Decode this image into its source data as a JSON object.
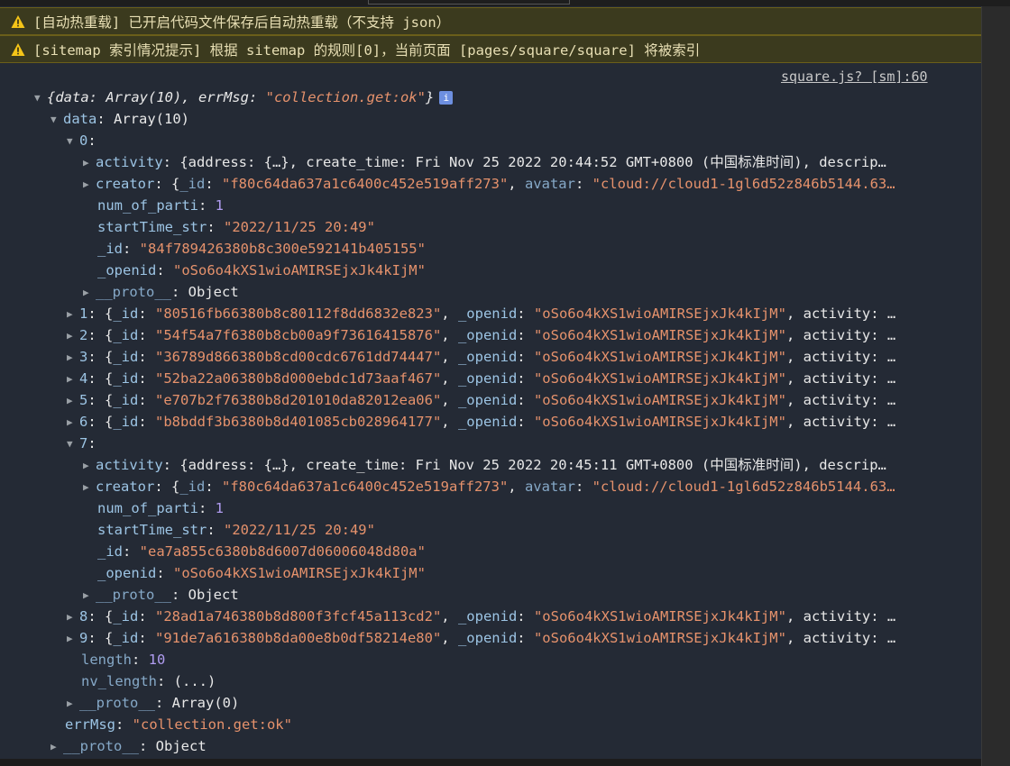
{
  "warnings": [
    "[自动热重载] 已开启代码文件保存后自动热重载（不支持 json）",
    "[sitemap 索引情况提示] 根据 sitemap 的规则[0]，当前页面 [pages/square/square] 将被索引"
  ],
  "source_link": "square.js? [sm]:60",
  "summary": {
    "prefix": "{data: Array(10), errMsg: ",
    "errmsg_value": "\"collection.get:ok\"",
    "suffix": "}",
    "info_badge": "i"
  },
  "data_line": {
    "key": "data",
    "value": "Array(10)"
  },
  "item0": {
    "index": "0",
    "activity_value": "{address: {…}, create_time: Fri Nov 25 2022 20:44:52 GMT+0800 (中国标准时间), descrip…",
    "creator_id": "\"f80c64da637a1c6400c452e519aff273\"",
    "creator_avatar": "\"cloud://cloud1-1gl6d52z846b5144.63…",
    "num_of_parti": "1",
    "startTime_str": "\"2022/11/25 20:49\"",
    "_id": "\"84f789426380b8c300e592141b405155\"",
    "_openid": "\"oSo6o4kXS1wioAMIRSEjxJk4kIjM\""
  },
  "item7": {
    "index": "7",
    "activity_value": "{address: {…}, create_time: Fri Nov 25 2022 20:45:11 GMT+0800 (中国标准时间), descrip…",
    "creator_id": "\"f80c64da637a1c6400c452e519aff273\"",
    "creator_avatar": "\"cloud://cloud1-1gl6d52z846b5144.63…",
    "num_of_parti": "1",
    "startTime_str": "\"2022/11/25 20:49\"",
    "_id": "\"ea7a855c6380b8d6007d06006048d80a\"",
    "_openid": "\"oSo6o4kXS1wioAMIRSEjxJk4kIjM\""
  },
  "collapsed_items_a": [
    {
      "index": "1",
      "id": "\"80516fb66380b8c80112f8dd6832e823\"",
      "openid": "\"oSo6o4kXS1wioAMIRSEjxJk4kIjM\""
    },
    {
      "index": "2",
      "id": "\"54f54a7f6380b8cb00a9f73616415876\"",
      "openid": "\"oSo6o4kXS1wioAMIRSEjxJk4kIjM\""
    },
    {
      "index": "3",
      "id": "\"36789d866380b8cd00cdc6761dd74447\"",
      "openid": "\"oSo6o4kXS1wioAMIRSEjxJk4kIjM\""
    },
    {
      "index": "4",
      "id": "\"52ba22a06380b8d000ebdc1d73aaf467\"",
      "openid": "\"oSo6o4kXS1wioAMIRSEjxJk4kIjM\""
    },
    {
      "index": "5",
      "id": "\"e707b2f76380b8d201010da82012ea06\"",
      "openid": "\"oSo6o4kXS1wioAMIRSEjxJk4kIjM\""
    },
    {
      "index": "6",
      "id": "\"b8bddf3b6380b8d401085cb028964177\"",
      "openid": "\"oSo6o4kXS1wioAMIRSEjxJk4kIjM\""
    }
  ],
  "collapsed_items_b": [
    {
      "index": "8",
      "id": "\"28ad1a746380b8d800f3fcf45a113cd2\"",
      "openid": "\"oSo6o4kXS1wioAMIRSEjxJk4kIjM\""
    },
    {
      "index": "9",
      "id": "\"91de7a616380b8da00e8b0df58214e80\"",
      "openid": "\"oSo6o4kXS1wioAMIRSEjxJk4kIjM\""
    }
  ],
  "labels": {
    "activity": "activity",
    "creator": "creator",
    "id_key": "_id",
    "avatar_key": "avatar",
    "openid_key": "_openid",
    "num_of_parti": "num_of_parti",
    "startTime_str": "startTime_str",
    "proto": "__proto__",
    "object": "Object",
    "activity_tail": "activity: …",
    "length": "length",
    "nv_length": "nv_length",
    "getter": "(...)",
    "array0": "Array(0)",
    "errMsg": "errMsg"
  },
  "array_meta": {
    "length_value": "10"
  },
  "errMsg_value": "\"collection.get:ok\"",
  "colors": {
    "panel_bg": "#242a35",
    "warning_bg": "#3b3a1e",
    "warning_icon": "#f5c518",
    "string": "#e6926c",
    "number": "#b09cf0",
    "key": "#9cc4e4"
  }
}
